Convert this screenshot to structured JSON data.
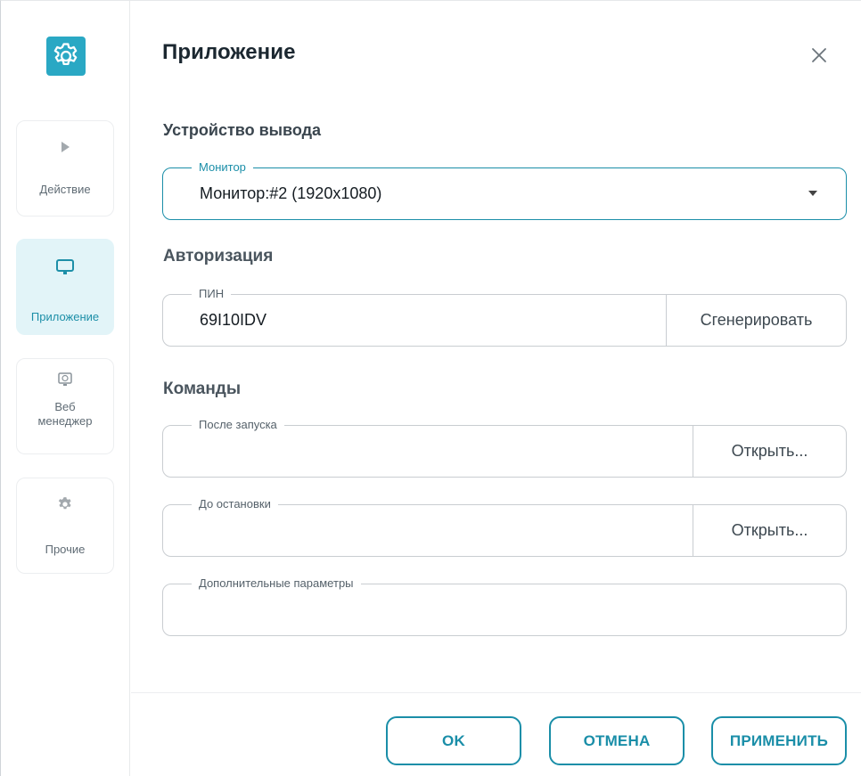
{
  "colors": {
    "accent": "#1a8ea8",
    "active_bg": "#e2f4f8",
    "logo_bg": "#2aa8c4"
  },
  "sidebar": {
    "logo_icon": "gear-icon",
    "items": [
      {
        "label": "Действие",
        "icon": "play-icon",
        "active": false
      },
      {
        "label": "Приложение",
        "icon": "monitor-icon",
        "active": true
      },
      {
        "label": "Веб менеджер",
        "icon": "web-manager-icon",
        "active": false
      },
      {
        "label": "Прочие",
        "icon": "gear-icon",
        "active": false
      }
    ]
  },
  "dialog": {
    "title": "Приложение",
    "close_icon": "close-icon"
  },
  "output_device": {
    "section_title": "Устройство вывода",
    "monitor": {
      "legend": "Монитор",
      "value": "Монитор:#2 (1920x1080)"
    }
  },
  "authorization": {
    "section_title": "Авторизация",
    "pin": {
      "legend": "ПИН",
      "value": "69I10IDV",
      "button": "Сгенерировать"
    }
  },
  "commands": {
    "section_title": "Команды",
    "after_start": {
      "legend": "После запуска",
      "value": "",
      "button": "Открыть..."
    },
    "before_stop": {
      "legend": "До остановки",
      "value": "",
      "button": "Открыть..."
    },
    "extra_params": {
      "legend": "Дополнительные параметры",
      "value": ""
    }
  },
  "footer": {
    "ok": "OK",
    "cancel": "ОТМЕНА",
    "apply": "ПРИМЕНИТЬ"
  }
}
